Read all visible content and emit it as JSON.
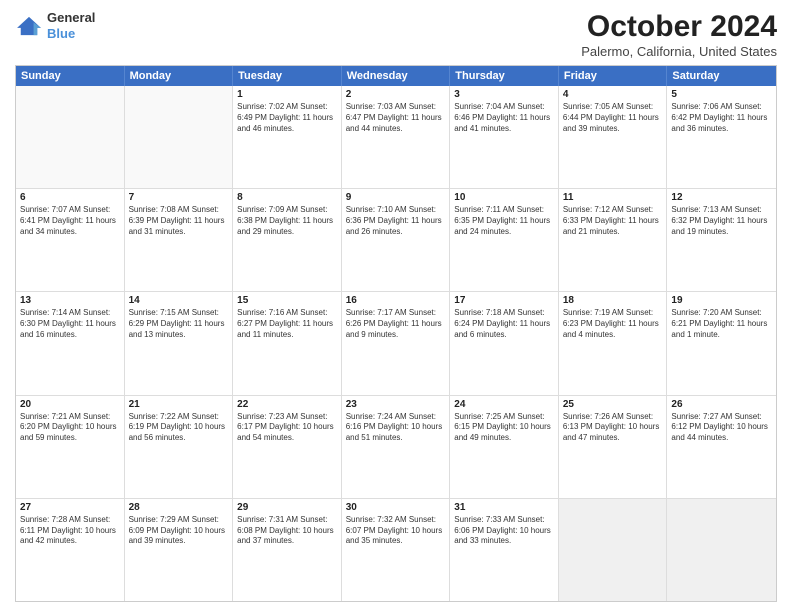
{
  "header": {
    "logo_line1": "General",
    "logo_line2": "Blue",
    "title": "October 2024",
    "subtitle": "Palermo, California, United States"
  },
  "days": [
    "Sunday",
    "Monday",
    "Tuesday",
    "Wednesday",
    "Thursday",
    "Friday",
    "Saturday"
  ],
  "weeks": [
    [
      {
        "day": "",
        "info": ""
      },
      {
        "day": "",
        "info": ""
      },
      {
        "day": "1",
        "info": "Sunrise: 7:02 AM\nSunset: 6:49 PM\nDaylight: 11 hours and 46 minutes."
      },
      {
        "day": "2",
        "info": "Sunrise: 7:03 AM\nSunset: 6:47 PM\nDaylight: 11 hours and 44 minutes."
      },
      {
        "day": "3",
        "info": "Sunrise: 7:04 AM\nSunset: 6:46 PM\nDaylight: 11 hours and 41 minutes."
      },
      {
        "day": "4",
        "info": "Sunrise: 7:05 AM\nSunset: 6:44 PM\nDaylight: 11 hours and 39 minutes."
      },
      {
        "day": "5",
        "info": "Sunrise: 7:06 AM\nSunset: 6:42 PM\nDaylight: 11 hours and 36 minutes."
      }
    ],
    [
      {
        "day": "6",
        "info": "Sunrise: 7:07 AM\nSunset: 6:41 PM\nDaylight: 11 hours and 34 minutes."
      },
      {
        "day": "7",
        "info": "Sunrise: 7:08 AM\nSunset: 6:39 PM\nDaylight: 11 hours and 31 minutes."
      },
      {
        "day": "8",
        "info": "Sunrise: 7:09 AM\nSunset: 6:38 PM\nDaylight: 11 hours and 29 minutes."
      },
      {
        "day": "9",
        "info": "Sunrise: 7:10 AM\nSunset: 6:36 PM\nDaylight: 11 hours and 26 minutes."
      },
      {
        "day": "10",
        "info": "Sunrise: 7:11 AM\nSunset: 6:35 PM\nDaylight: 11 hours and 24 minutes."
      },
      {
        "day": "11",
        "info": "Sunrise: 7:12 AM\nSunset: 6:33 PM\nDaylight: 11 hours and 21 minutes."
      },
      {
        "day": "12",
        "info": "Sunrise: 7:13 AM\nSunset: 6:32 PM\nDaylight: 11 hours and 19 minutes."
      }
    ],
    [
      {
        "day": "13",
        "info": "Sunrise: 7:14 AM\nSunset: 6:30 PM\nDaylight: 11 hours and 16 minutes."
      },
      {
        "day": "14",
        "info": "Sunrise: 7:15 AM\nSunset: 6:29 PM\nDaylight: 11 hours and 13 minutes."
      },
      {
        "day": "15",
        "info": "Sunrise: 7:16 AM\nSunset: 6:27 PM\nDaylight: 11 hours and 11 minutes."
      },
      {
        "day": "16",
        "info": "Sunrise: 7:17 AM\nSunset: 6:26 PM\nDaylight: 11 hours and 9 minutes."
      },
      {
        "day": "17",
        "info": "Sunrise: 7:18 AM\nSunset: 6:24 PM\nDaylight: 11 hours and 6 minutes."
      },
      {
        "day": "18",
        "info": "Sunrise: 7:19 AM\nSunset: 6:23 PM\nDaylight: 11 hours and 4 minutes."
      },
      {
        "day": "19",
        "info": "Sunrise: 7:20 AM\nSunset: 6:21 PM\nDaylight: 11 hours and 1 minute."
      }
    ],
    [
      {
        "day": "20",
        "info": "Sunrise: 7:21 AM\nSunset: 6:20 PM\nDaylight: 10 hours and 59 minutes."
      },
      {
        "day": "21",
        "info": "Sunrise: 7:22 AM\nSunset: 6:19 PM\nDaylight: 10 hours and 56 minutes."
      },
      {
        "day": "22",
        "info": "Sunrise: 7:23 AM\nSunset: 6:17 PM\nDaylight: 10 hours and 54 minutes."
      },
      {
        "day": "23",
        "info": "Sunrise: 7:24 AM\nSunset: 6:16 PM\nDaylight: 10 hours and 51 minutes."
      },
      {
        "day": "24",
        "info": "Sunrise: 7:25 AM\nSunset: 6:15 PM\nDaylight: 10 hours and 49 minutes."
      },
      {
        "day": "25",
        "info": "Sunrise: 7:26 AM\nSunset: 6:13 PM\nDaylight: 10 hours and 47 minutes."
      },
      {
        "day": "26",
        "info": "Sunrise: 7:27 AM\nSunset: 6:12 PM\nDaylight: 10 hours and 44 minutes."
      }
    ],
    [
      {
        "day": "27",
        "info": "Sunrise: 7:28 AM\nSunset: 6:11 PM\nDaylight: 10 hours and 42 minutes."
      },
      {
        "day": "28",
        "info": "Sunrise: 7:29 AM\nSunset: 6:09 PM\nDaylight: 10 hours and 39 minutes."
      },
      {
        "day": "29",
        "info": "Sunrise: 7:31 AM\nSunset: 6:08 PM\nDaylight: 10 hours and 37 minutes."
      },
      {
        "day": "30",
        "info": "Sunrise: 7:32 AM\nSunset: 6:07 PM\nDaylight: 10 hours and 35 minutes."
      },
      {
        "day": "31",
        "info": "Sunrise: 7:33 AM\nSunset: 6:06 PM\nDaylight: 10 hours and 33 minutes."
      },
      {
        "day": "",
        "info": ""
      },
      {
        "day": "",
        "info": ""
      }
    ]
  ]
}
